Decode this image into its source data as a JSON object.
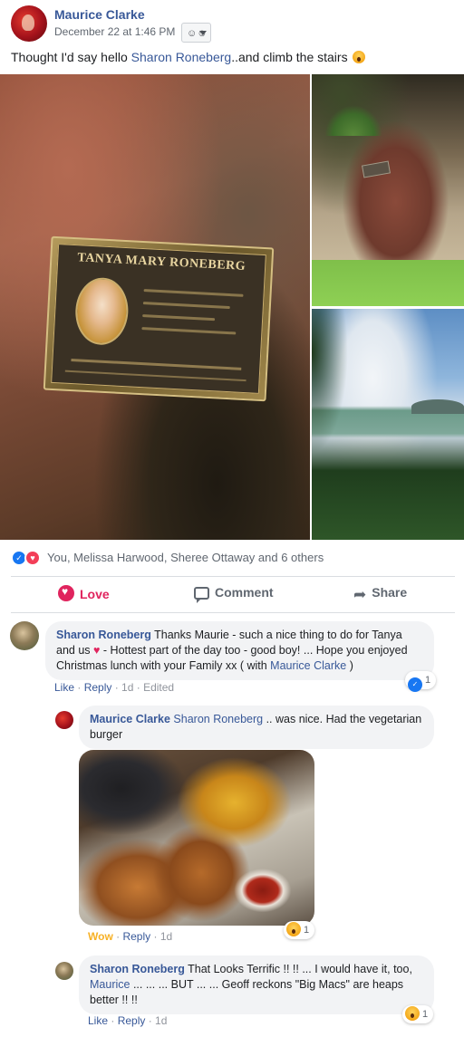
{
  "post": {
    "author": "Maurice Clarke",
    "time": "December 22 at 1:46 PM",
    "text_before": "Thought I'd say hello ",
    "text_mention": "Sharon Roneberg",
    "text_after": "..and climb the stairs",
    "photos": {
      "plaque_title": "TANYA MARY RONEBERG"
    }
  },
  "reactions": {
    "summary": "You, Melissa Harwood, Sheree Ottaway and 6 others"
  },
  "actions": {
    "love": "Love",
    "comment": "Comment",
    "share": "Share"
  },
  "comments": [
    {
      "author": "Sharon Roneberg",
      "text_a": " Thanks Maurie - such a nice thing to do for Tanya and us ",
      "text_b": " - Hottest part of the day too - good boy! ... Hope you enjoyed Christmas lunch with your Family xx ( with ",
      "mention": "Maurice Clarke",
      "text_c": " )",
      "like": "Like",
      "reply": "Reply",
      "age": "1d",
      "edited": "Edited",
      "reaction_count": "1"
    },
    {
      "author": "Maurice Clarke",
      "mention": "Sharon Roneberg",
      "text": " .. was nice. Had the vegetarian burger",
      "like": "Wow",
      "reply": "Reply",
      "age": "1d",
      "reaction_count": "1"
    },
    {
      "author": "Sharon Roneberg",
      "text_a": " That Looks Terrific !! !! ... I would have it, too, ",
      "mention": "Maurice",
      "text_b": " ... ... ... BUT ... ... Geoff reckons \"Big Macs\" are heaps better !! !!",
      "like": "Like",
      "reply": "Reply",
      "age": "1d",
      "reaction_count": "1"
    }
  ]
}
